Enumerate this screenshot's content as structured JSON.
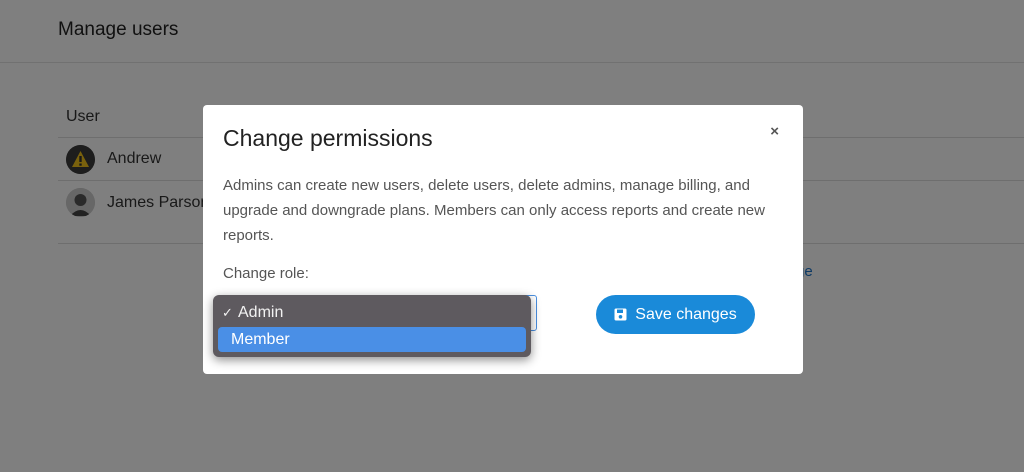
{
  "page": {
    "title": "Manage users"
  },
  "table": {
    "header_user": "User",
    "rows": [
      {
        "name": "Andrew"
      },
      {
        "name": "James Parsons"
      }
    ],
    "link_fragment": "ge"
  },
  "modal": {
    "title": "Change permissions",
    "close": "×",
    "description": "Admins can create new users, delete users, delete admins, manage billing, and upgrade and downgrade plans. Members can only access reports and create new reports.",
    "role_label": "Change role:",
    "save_label": "Save changes"
  },
  "dropdown": {
    "checkmark": "✓",
    "options": [
      {
        "label": "Admin",
        "selected": true
      },
      {
        "label": "Member",
        "highlighted": true
      }
    ]
  },
  "colors": {
    "accent": "#1a8ad9",
    "highlight": "#4a8fe6",
    "overlay": "rgba(0,0,0,0.5)"
  }
}
